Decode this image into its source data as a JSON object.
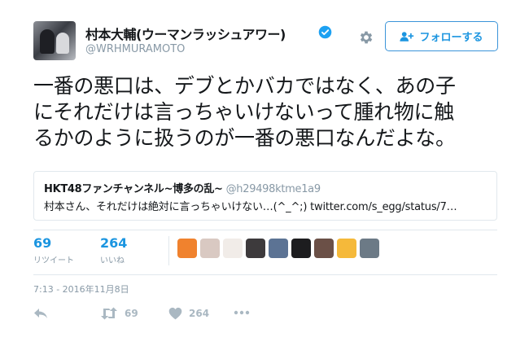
{
  "user": {
    "display_name": "村本大輔(ウーマンラッシュアワー)",
    "handle": "@WRHMURAMOTO",
    "verified": true
  },
  "follow_button": {
    "label": "フォローする"
  },
  "tweet": {
    "lines": [
      "一番の悪口は、デブとかバカではなく、あの子",
      "にそれだけは言っちゃいけないって腫れ物に触",
      "るかのように扱うのが一番の悪口なんだよな。"
    ]
  },
  "quote": {
    "name": "HKT48ファンチャンネル~博多の乱~",
    "handle": "@h29498ktme1a9",
    "text": "村本さん、それだけは絶対に言っちゃいけない…(^_^;) twitter.com/s_egg/status/7…"
  },
  "stats": {
    "retweets": {
      "count": "69",
      "label": "リツイート"
    },
    "likes": {
      "count": "264",
      "label": "いいね"
    }
  },
  "liker_avatar_colors": [
    "#f0822e",
    "#d9c9c2",
    "#f1ece8",
    "#3d3a3c",
    "#5c7394",
    "#1d1d1f",
    "#6b5047",
    "#f5b93a",
    "#6c7a86"
  ],
  "timestamp": "7:13 - 2016年11月8日",
  "actions": {
    "retweet_count": "69",
    "like_count": "264"
  },
  "colors": {
    "accent": "#1b95e0",
    "muted": "#8899a6",
    "icon_muted": "#aab8c2",
    "verified": "#1da1f2"
  }
}
